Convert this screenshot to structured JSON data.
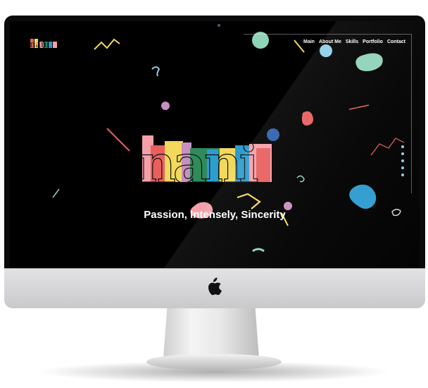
{
  "site": {
    "logo_text": "nani",
    "hero_logo_text": "nani",
    "tagline": "Passion, Intensely, Sincerity"
  },
  "nav": {
    "items": [
      "Main",
      "About Me",
      "Skills",
      "Portfolio",
      "Contact"
    ]
  },
  "section_indicator": {
    "count": 5
  },
  "colors": {
    "background": "#000000",
    "accent_red": "#e8605e",
    "accent_yellow": "#f2d95c",
    "accent_blue": "#2e9ccf",
    "accent_pink": "#f5a0a8",
    "accent_mint": "#8fd3b8",
    "accent_green": "#2f8b5a"
  },
  "icons": {
    "device_logo": "apple-icon"
  }
}
